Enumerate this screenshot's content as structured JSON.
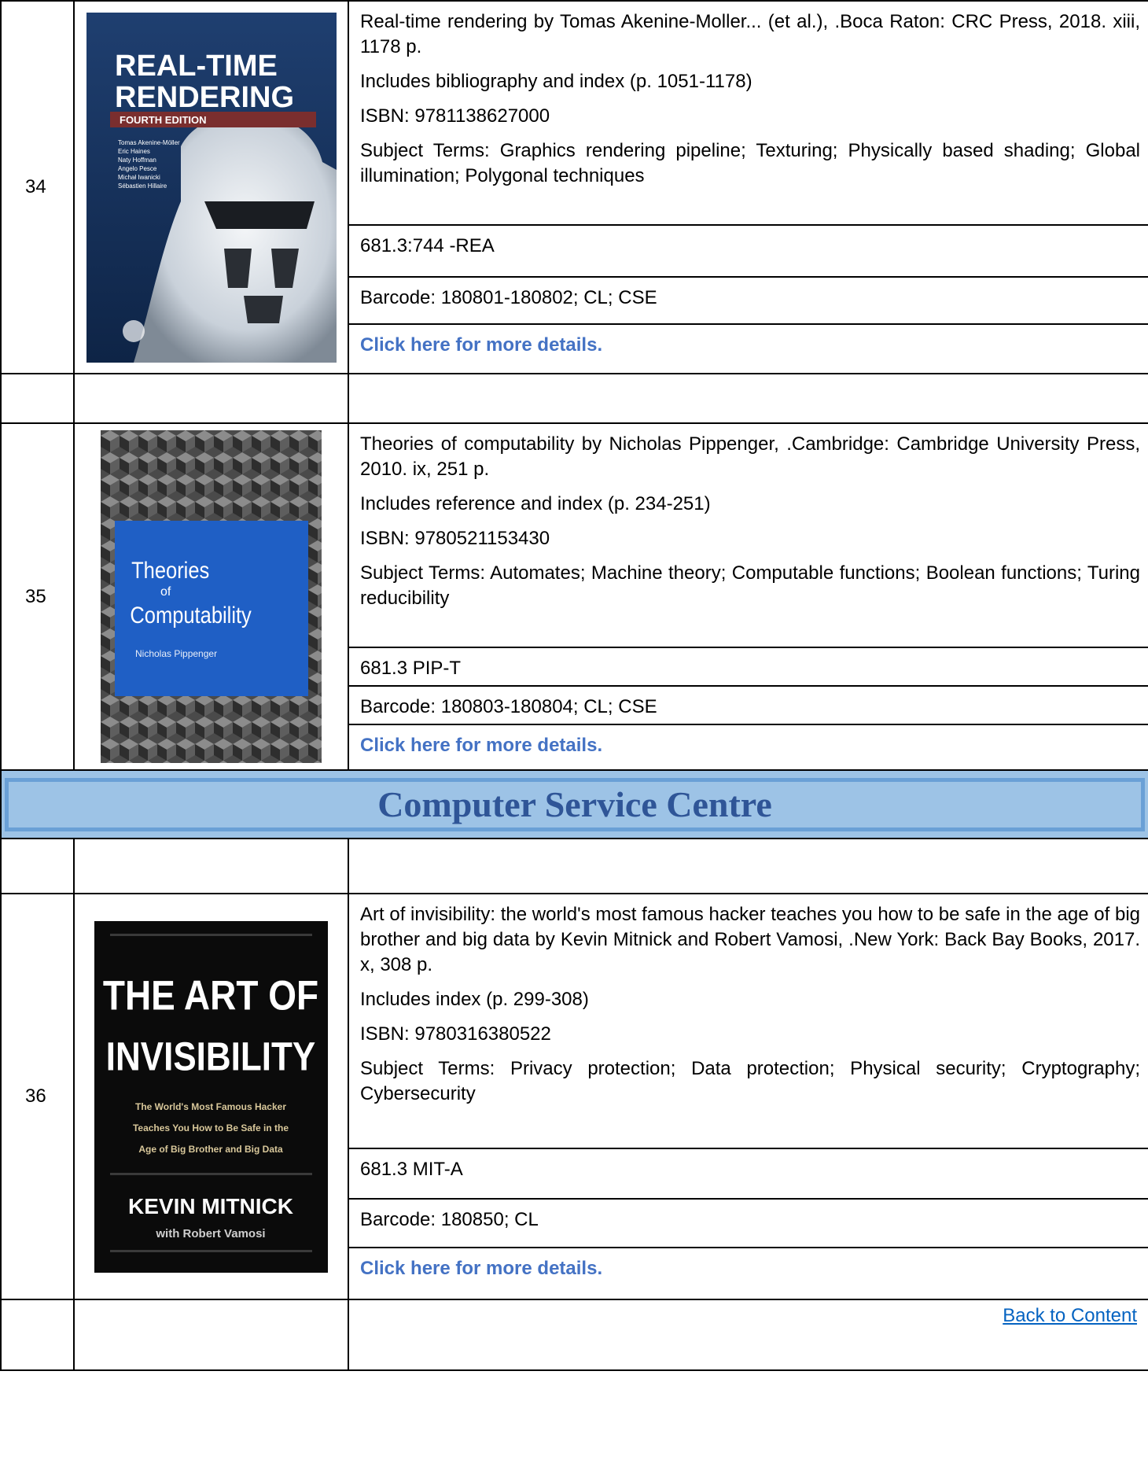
{
  "entries": [
    {
      "number": "34",
      "citation": "Real-time rendering by Tomas Akenine-Moller... (et al.), .Boca Raton: CRC Press, 2018. xiii, 1178 p.",
      "notes": "Includes bibliography and index (p. 1051-1178)",
      "isbn": "ISBN: 9781138627000",
      "subjects": "Subject Terms: Graphics rendering pipeline; Texturing; Physically based shading; Global illumination; Polygonal techniques",
      "call_number": "681.3:744 -REA",
      "barcode": "Barcode: 180801-180802; CL; CSE",
      "details_link": "Click here for more details.",
      "cover": {
        "title_line1": "REAL-TIME",
        "title_line2": "RENDERING",
        "edition": "FOURTH EDITION",
        "authors": [
          "Tomas Akenine-Möller",
          "Eric Haines",
          "Naty Hoffman",
          "Angelo Pesce",
          "Michał Iwanicki",
          "Sébastien Hillaire"
        ]
      }
    },
    {
      "number": "35",
      "citation": "Theories of computability by Nicholas Pippenger, .Cambridge: Cambridge University Press, 2010. ix, 251 p.",
      "notes": "Includes reference and index (p. 234-251)",
      "isbn": "ISBN: 9780521153430",
      "subjects": "Subject Terms: Automates; Machine theory; Computable functions; Boolean functions; Turing reducibility",
      "call_number": "681.3 PIP-T",
      "barcode": "Barcode: 180803-180804; CL; CSE",
      "details_link": "Click here for more details.",
      "cover": {
        "title_line1": "Theories",
        "title_line2": "of",
        "title_line3": "Computability",
        "author": "Nicholas Pippenger"
      }
    },
    {
      "number": "36",
      "citation": "Art of invisibility: the world's most famous hacker teaches you how to be safe in the age of big brother and big data by Kevin Mitnick and Robert Vamosi, .New York: Back Bay Books, 2017. x, 308 p.",
      "notes": "Includes index (p. 299-308)",
      "isbn": "ISBN: 9780316380522",
      "subjects": "Subject Terms: Privacy protection; Data protection; Physical security; Cryptography; Cybersecurity",
      "call_number": "681.3 MIT-A",
      "barcode": "Barcode: 180850; CL",
      "details_link": "Click here for more details.",
      "cover": {
        "title_line1": "THE ART OF",
        "title_line2": "INVISIBILITY",
        "tagline": [
          "The World's Most Famous Hacker",
          "Teaches You How to Be Safe in the",
          "Age of Big Brother and Big Data"
        ],
        "author": "KEVIN MITNICK",
        "coauthor": "with Robert Vamosi"
      }
    }
  ],
  "section_header": "Computer Service Centre",
  "back_link": "Back to Content",
  "colors": {
    "link_blue": "#4472c4",
    "header_bg": "#9dc3e6",
    "header_text": "#2f5597"
  }
}
